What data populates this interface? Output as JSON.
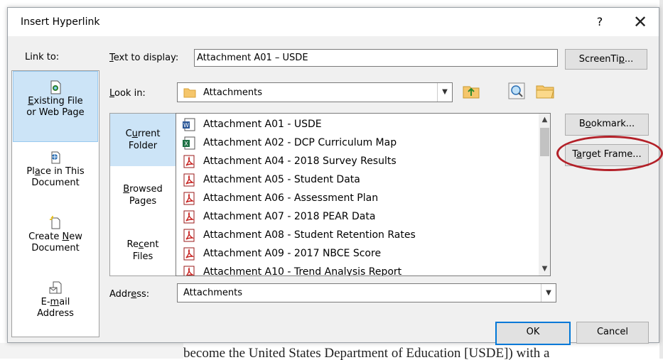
{
  "dialog": {
    "title": "Insert Hyperlink",
    "help_label": "?",
    "close_label": "✕"
  },
  "link_to": {
    "label": "Link to:",
    "items": [
      {
        "line1": "Existing File",
        "line2": "or Web Page",
        "icon": "existing-file-icon",
        "selected": true
      },
      {
        "line1": "Place in This",
        "line2": "Document",
        "icon": "place-in-document-icon",
        "selected": false
      },
      {
        "line1": "Create New",
        "line2": "Document",
        "icon": "create-new-document-icon",
        "selected": false
      },
      {
        "line1": "E-mail",
        "line2": "Address",
        "icon": "email-address-icon",
        "selected": false
      }
    ]
  },
  "text_to_display": {
    "label": "Text to display:",
    "value": "Attachment A01 – USDE"
  },
  "screentip_label": "ScreenTip...",
  "look_in": {
    "label": "Look in:",
    "value": "Attachments"
  },
  "places": [
    {
      "line1": "Current",
      "line2": "Folder",
      "selected": true
    },
    {
      "line1": "Browsed",
      "line2": "Pages",
      "selected": false
    },
    {
      "line1": "Recent",
      "line2": "Files",
      "selected": false
    }
  ],
  "files": [
    {
      "name": "Attachment A01 - USDE",
      "type": "word"
    },
    {
      "name": "Attachment A02 - DCP Curriculum Map",
      "type": "excel"
    },
    {
      "name": "Attachment A04 - 2018 Survey Results",
      "type": "pdf"
    },
    {
      "name": "Attachment A05 - Student Data",
      "type": "pdf"
    },
    {
      "name": "Attachment A06 - Assessment Plan",
      "type": "pdf"
    },
    {
      "name": "Attachment A07 - 2018 PEAR Data",
      "type": "pdf"
    },
    {
      "name": "Attachment A08 - Student Retention Rates",
      "type": "pdf"
    },
    {
      "name": "Attachment A09 - 2017 NBCE Score",
      "type": "pdf"
    },
    {
      "name": "Attachment A10 - Trend Analysis Report",
      "type": "pdf"
    }
  ],
  "bookmark_label": "Bookmark...",
  "target_frame_label": "Target Frame...",
  "address": {
    "label": "Address:",
    "value": "Attachments"
  },
  "ok_label": "OK",
  "cancel_label": "Cancel",
  "background_doc_text": "become the United States Department of Education [USDE]) with a",
  "colors": {
    "selection": "#cce4f7",
    "highlight_circle": "#b32028",
    "ok_border": "#0078d7"
  }
}
